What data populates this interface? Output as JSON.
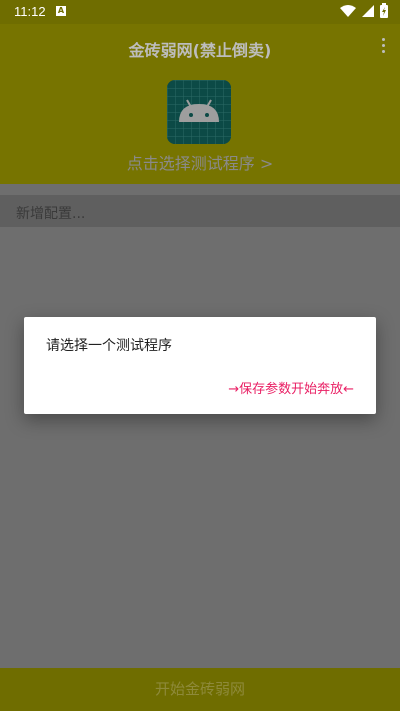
{
  "status_bar": {
    "time": "11:12",
    "notification_icon": "A",
    "icons": [
      "wifi-icon",
      "signal-icon",
      "battery-icon"
    ]
  },
  "header": {
    "title": "金砖弱网(禁止倒卖)",
    "select_program": "点击选择测试程序 >",
    "menu_icon": "more-vert-icon",
    "app_icon": "android-icon"
  },
  "content": {
    "config_label": "新增配置..."
  },
  "dialog": {
    "message": "请选择一个测试程序",
    "action": "→保存参数开始奔放←"
  },
  "footer": {
    "start_button": "开始金砖弱网"
  },
  "colors": {
    "header_bg": "#777400",
    "status_bg": "#6f6d00",
    "scrim_bg": "#6e6e6e",
    "accent": "#e91e63"
  }
}
